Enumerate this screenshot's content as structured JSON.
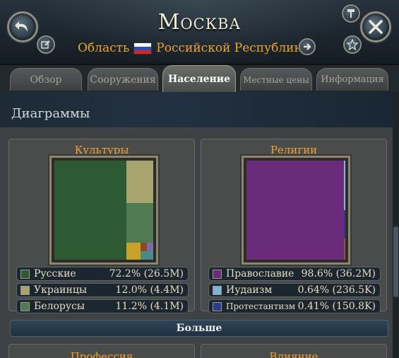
{
  "header": {
    "title": "Москва",
    "area_label": "Область",
    "republic_label": "Российской Республики",
    "flag_colors": [
      "#ffffff",
      "#2b4fb5",
      "#d32626"
    ]
  },
  "tabs": [
    {
      "label": "Обзор",
      "active": false
    },
    {
      "label": "Сооружения",
      "active": false
    },
    {
      "label": "Население",
      "active": true
    },
    {
      "label": "Местные цены",
      "active": false
    },
    {
      "label": "Информация",
      "active": false
    }
  ],
  "section": {
    "title": "Диаграммы"
  },
  "cultures": {
    "title": "Культуры",
    "items": [
      {
        "name": "Русские",
        "value": "72.2% (26.5M)",
        "color": "#2d5a33"
      },
      {
        "name": "Украинцы",
        "value": "12.0% (4.4M)",
        "color": "#a8a470"
      },
      {
        "name": "Белорусы",
        "value": "11.2% (4.1M)",
        "color": "#4f7a52"
      }
    ]
  },
  "religions": {
    "title": "Религии",
    "items": [
      {
        "name": "Православие",
        "value": "98.6% (36.2M)",
        "color": "#6a2c7a"
      },
      {
        "name": "Иудаизм",
        "value": "0.64% (236.5K)",
        "color": "#7fb4d8"
      },
      {
        "name": "Протестантизм",
        "value": "0.41% (150.8K)",
        "color": "#2a3d86"
      }
    ]
  },
  "more_button": "Больше",
  "lower_panels": [
    "Профессия",
    "Влияние"
  ],
  "icons": [
    "back-arrow-icon",
    "edit-icon",
    "hammer-icon",
    "close-icon",
    "star-icon",
    "arrow-right-icon"
  ]
}
